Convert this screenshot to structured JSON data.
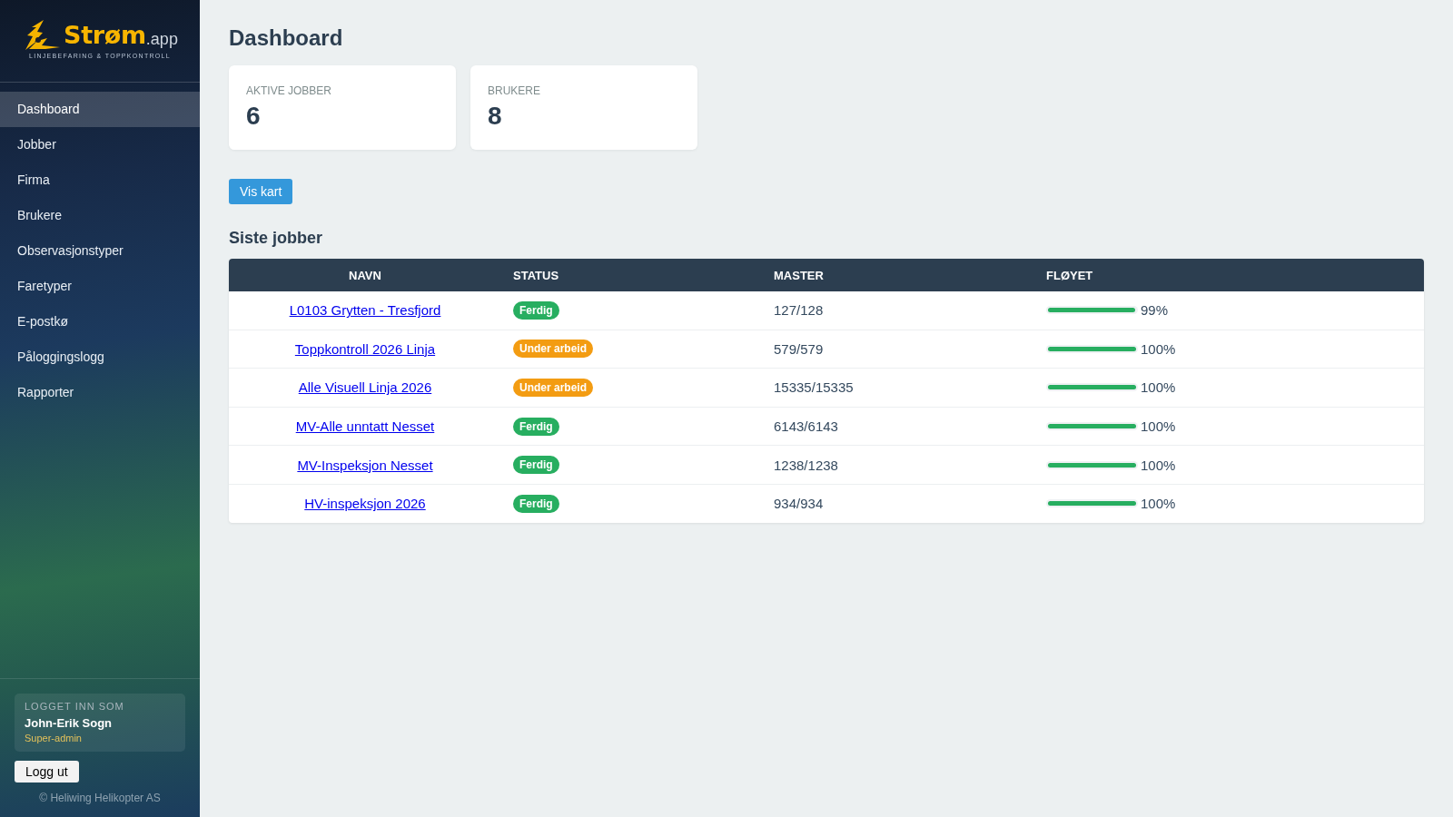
{
  "sidebar": {
    "logo": {
      "name": "Strøm",
      "suffix": ".app",
      "tagline": "LINJEBEFARING & TOPPKONTROLL"
    },
    "items": [
      {
        "label": "Dashboard",
        "selected": true
      },
      {
        "label": "Jobber",
        "selected": false
      },
      {
        "label": "Firma",
        "selected": false
      },
      {
        "label": "Brukere",
        "selected": false
      },
      {
        "label": "Observasjonstyper",
        "selected": false
      },
      {
        "label": "Faretyper",
        "selected": false
      },
      {
        "label": "E-postkø",
        "selected": false
      },
      {
        "label": "Påloggingslogg",
        "selected": false
      },
      {
        "label": "Rapporter",
        "selected": false
      }
    ],
    "user": {
      "caption": "LOGGET INN SOM",
      "name": "John-Erik Sogn",
      "role": "Super-admin"
    },
    "logout_button": "Logg ut",
    "footer": "© Heliwing Helikopter AS"
  },
  "page": {
    "title": "Dashboard",
    "stats": [
      {
        "label": "AKTIVE JOBBER",
        "value": "6"
      },
      {
        "label": "BRUKERE",
        "value": "8"
      }
    ],
    "map_button": "Vis kart",
    "jobs": {
      "title": "Siste jobber",
      "columns": [
        "NAVN",
        "STATUS",
        "MASTER",
        "FLØYET"
      ],
      "rows": [
        {
          "name": "L0103 Grytten - Tresfjord",
          "status": {
            "label": "Ferdig",
            "color": "#27ae60"
          },
          "masts": "127/128",
          "level": 0.99,
          "flown": "99%"
        },
        {
          "name": "Toppkontroll 2026 Linja",
          "status": {
            "label": "Under arbeid",
            "color": "#f39c12"
          },
          "masts": "579/579",
          "level": 1,
          "flown": "100%"
        },
        {
          "name": "Alle Visuell Linja 2026",
          "status": {
            "label": "Under arbeid",
            "color": "#f39c12"
          },
          "masts": "15335/15335",
          "level": 1,
          "flown": "100%"
        },
        {
          "name": "MV-Alle unntatt Nesset",
          "status": {
            "label": "Ferdig",
            "color": "#27ae60"
          },
          "masts": "6143/6143",
          "level": 1,
          "flown": "100%"
        },
        {
          "name": "MV-Inspeksjon Nesset",
          "status": {
            "label": "Ferdig",
            "color": "#27ae60"
          },
          "masts": "1238/1238",
          "level": 1,
          "flown": "100%"
        },
        {
          "name": "HV-inspeksjon 2026",
          "status": {
            "label": "Ferdig",
            "color": "#27ae60"
          },
          "masts": "934/934",
          "level": 1,
          "flown": "100%"
        }
      ]
    }
  }
}
